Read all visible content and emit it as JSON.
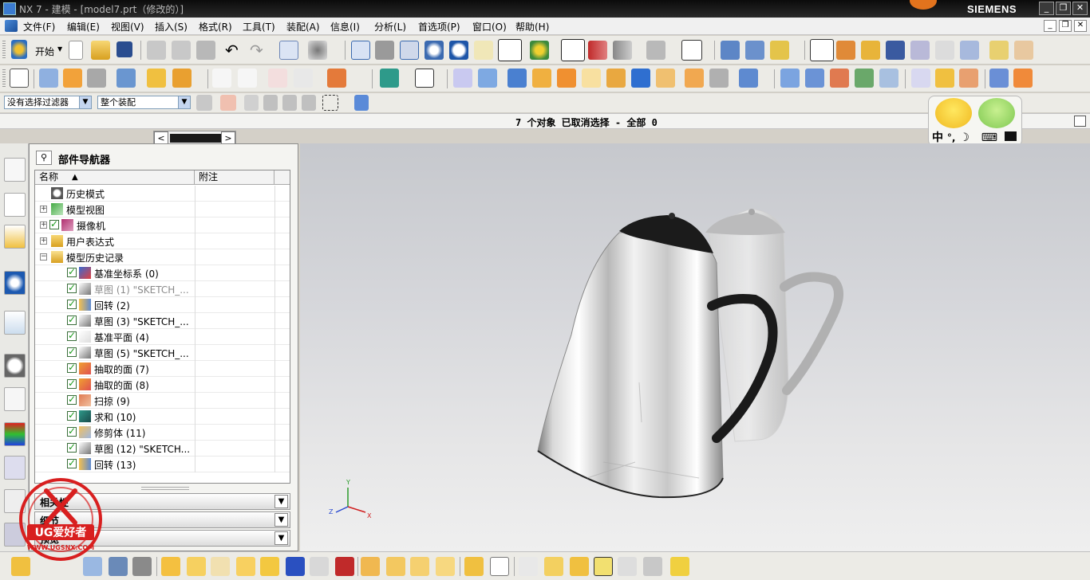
{
  "window": {
    "title": "NX 7 - 建模 - [model7.prt（修改的）]",
    "brand": "SIEMENS",
    "controls": [
      "_",
      "❐",
      "✕"
    ]
  },
  "menubar": {
    "items": [
      "文件(F)",
      "编辑(E)",
      "视图(V)",
      "插入(S)",
      "格式(R)",
      "工具(T)",
      "装配(A)",
      "信息(I)",
      "分析(L)",
      "首选项(P)",
      "窗口(O)",
      "帮助(H)"
    ],
    "mdi_controls": [
      "_",
      "❐",
      "✕"
    ]
  },
  "toolbar": {
    "start_label": "开始",
    "selection_filter": "没有选择过滤器",
    "assembly_scope": "整个装配"
  },
  "status": {
    "message": "7 个对象 已取消选择  - 全部 0"
  },
  "ime": {
    "label": "中",
    "symbols": "°,",
    "moon": "☽",
    "keyboard": "⌨",
    "shirt": "👕"
  },
  "navigator": {
    "title": "部件导航器",
    "columns": [
      "名称",
      "附注"
    ],
    "sort_indicator": "▲",
    "rows": [
      {
        "level": 0,
        "expander": "",
        "checked": false,
        "icon": "clock-icon",
        "text": "历史模式",
        "dim": false
      },
      {
        "level": 0,
        "expander": "+",
        "checked": false,
        "icon": "model-views-icon",
        "text": "模型视图",
        "dim": false
      },
      {
        "level": 0,
        "expander": "+",
        "checked": true,
        "icon": "camera-icon",
        "text": "摄像机",
        "dim": false
      },
      {
        "level": 0,
        "expander": "+",
        "checked": false,
        "icon": "folder-icon",
        "text": "用户表达式",
        "dim": false
      },
      {
        "level": 0,
        "expander": "−",
        "checked": false,
        "icon": "folder-open-icon",
        "text": "模型历史记录",
        "dim": false
      },
      {
        "level": 1,
        "expander": "",
        "checked": true,
        "icon": "datum-csys-icon",
        "text": "基准坐标系 (0)",
        "dim": false
      },
      {
        "level": 1,
        "expander": "",
        "checked": true,
        "icon": "sketch-icon",
        "text": "草图 (1) \"SKETCH_...",
        "dim": true
      },
      {
        "level": 1,
        "expander": "",
        "checked": true,
        "icon": "revolve-icon",
        "text": "回转 (2)",
        "dim": false
      },
      {
        "level": 1,
        "expander": "",
        "checked": true,
        "icon": "sketch-icon",
        "text": "草图 (3) \"SKETCH_...",
        "dim": false
      },
      {
        "level": 1,
        "expander": "",
        "checked": true,
        "icon": "datum-plane-icon",
        "text": "基准平面 (4)",
        "dim": false
      },
      {
        "level": 1,
        "expander": "",
        "checked": true,
        "icon": "sketch-icon",
        "text": "草图 (5) \"SKETCH_...",
        "dim": false
      },
      {
        "level": 1,
        "expander": "",
        "checked": true,
        "icon": "extract-face-icon",
        "text": "抽取的面 (7)",
        "dim": false
      },
      {
        "level": 1,
        "expander": "",
        "checked": true,
        "icon": "extract-face-icon",
        "text": "抽取的面 (8)",
        "dim": false
      },
      {
        "level": 1,
        "expander": "",
        "checked": true,
        "icon": "sweep-icon",
        "text": "扫掠 (9)",
        "dim": false
      },
      {
        "level": 1,
        "expander": "",
        "checked": true,
        "icon": "unite-icon",
        "text": "求和 (10)",
        "dim": false
      },
      {
        "level": 1,
        "expander": "",
        "checked": true,
        "icon": "trim-body-icon",
        "text": "修剪体 (11)",
        "dim": false
      },
      {
        "level": 1,
        "expander": "",
        "checked": true,
        "icon": "sketch-icon",
        "text": "草图 (12) \"SKETCH...",
        "dim": false
      },
      {
        "level": 1,
        "expander": "",
        "checked": true,
        "icon": "revolve-icon",
        "text": "回转 (13)",
        "dim": false
      }
    ],
    "panels": [
      "相关性",
      "细节",
      "预览"
    ]
  },
  "graphics": {
    "triad": {
      "x": "X",
      "y": "Y",
      "z": "Z"
    }
  },
  "watermark": {
    "brand": "UG爱好者",
    "url": "WWW.UGSNX.COM"
  },
  "colors": {
    "title_bar": "#0b0b0b",
    "accent_orange": "#e2731d",
    "checkbox_green": "#1a9a1a",
    "watermark_red": "#d81f1f"
  }
}
